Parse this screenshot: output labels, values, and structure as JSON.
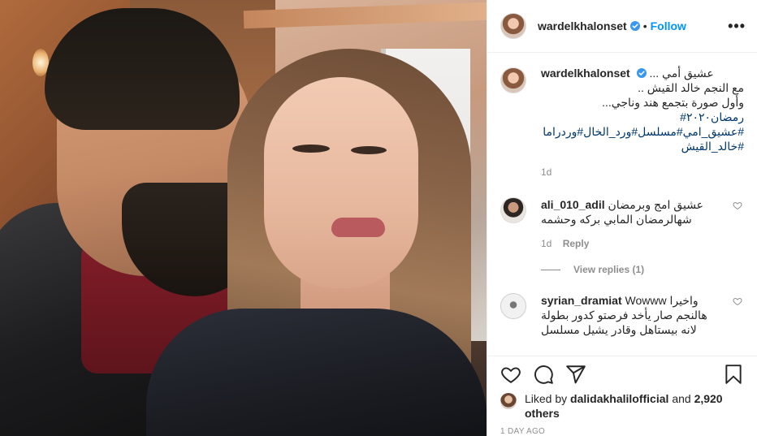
{
  "post": {
    "username": "wardelkhalonset",
    "follow_label": "Follow",
    "separator": "•",
    "more_label": "•••"
  },
  "caption": {
    "username": "wardelkhalonset",
    "first_line": "عشيق أمي ...",
    "lines": [
      "مع النجم خالد القيش ..",
      "وأول صورة بتجمع هند وناجي...",
      "رمضان٢٠٢٠#"
    ],
    "hashtags_line1": "#عشيق_امي#مسلسل#ورد_الخال#وردراما",
    "hashtags_line2": "#خالد_القيش",
    "time": "1d"
  },
  "comments": [
    {
      "username": "ali_010_adil",
      "text": "عشيق امج وبرمضان شهالرمضان المابي بركه وحشمه",
      "time": "1d",
      "reply_label": "Reply",
      "view_replies": "View replies (1)"
    },
    {
      "username": "syrian_dramiat",
      "text": "Wowww واخيرا هالنجم صار يأخد فرصتو كدور بطولة لانه بيستاهل وقادر يشيل مسلسل"
    }
  ],
  "likes": {
    "prefix": "Liked by",
    "by_user": "dalidakhalilofficial",
    "and": "and",
    "others": "2,920 others"
  },
  "post_time": "1 DAY AGO",
  "colors": {
    "accent": "#0095f6",
    "hashtag": "#00376b",
    "muted": "#8e8e8e",
    "text": "#262626"
  },
  "icons": {
    "verified": "verified-badge-icon",
    "like": "heart-icon",
    "comment": "comment-bubble-icon",
    "share": "paper-plane-icon",
    "save": "bookmark-icon",
    "more": "more-options-icon"
  }
}
